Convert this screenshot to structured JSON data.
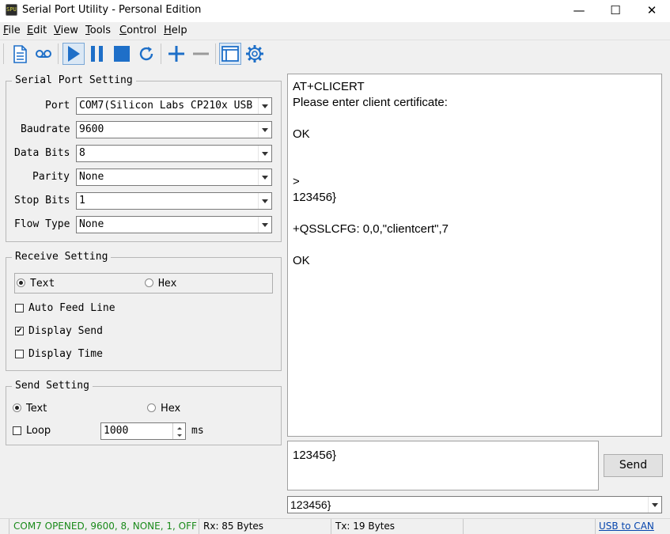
{
  "window": {
    "title": "Serial Port Utility - Personal Edition",
    "app_icon_text": "SPU",
    "minimize_glyph": "—",
    "maximize_glyph": "☐",
    "close_glyph": "✕"
  },
  "menu": {
    "items": [
      {
        "accel": "F",
        "rest": "ile"
      },
      {
        "accel": "E",
        "rest": "dit"
      },
      {
        "accel": "V",
        "rest": "iew"
      },
      {
        "accel": "T",
        "rest": "ools"
      },
      {
        "accel": "C",
        "rest": "ontrol"
      },
      {
        "accel": "H",
        "rest": "elp"
      }
    ]
  },
  "toolbar": {
    "icons": [
      "new-document-icon",
      "record-icon",
      "play-icon",
      "pause-icon",
      "stop-icon",
      "refresh-icon",
      "add-icon",
      "remove-icon",
      "window-icon",
      "gear-icon"
    ],
    "accent": "#1e6fc8"
  },
  "serial_port_setting": {
    "legend": "Serial Port Setting",
    "port_label": "Port",
    "port_value": "COM7(Silicon Labs CP210x USB",
    "baudrate_label": "Baudrate",
    "baudrate_value": "9600",
    "data_bits_label": "Data Bits",
    "data_bits_value": "8",
    "parity_label": "Parity",
    "parity_value": "None",
    "stop_bits_label": "Stop Bits",
    "stop_bits_value": "1",
    "flow_type_label": "Flow Type",
    "flow_type_value": "None"
  },
  "receive_setting": {
    "legend": "Receive Setting",
    "text_label": "Text",
    "hex_label": "Hex",
    "auto_feed_line_label": "Auto Feed Line",
    "display_send_label": "Display Send",
    "display_send_checked": "✔",
    "display_time_label": "Display Time"
  },
  "send_setting": {
    "legend": "Send Setting",
    "text_label": "Text",
    "hex_label": "Hex",
    "loop_label": "Loop",
    "interval_value": "1000",
    "interval_unit": "ms"
  },
  "receive_area": {
    "lines": [
      "AT+CLICERT",
      "Please enter client certificate:",
      "",
      "OK",
      "",
      "",
      ">",
      "123456}",
      "",
      "+QSSLCFG: 0,0,\"clientcert\",7",
      "",
      "OK"
    ]
  },
  "send_area": {
    "text": "123456}",
    "send_button": "Send",
    "history_value": "123456}"
  },
  "status_bar": {
    "connection": "COM7 OPENED, 9600, 8, NONE, 1, OFF",
    "connection_color": "#1a8a1a",
    "rx": "Rx: 85 Bytes",
    "tx": "Tx: 19 Bytes",
    "link": "USB to CAN",
    "link_color": "#0645ad"
  }
}
